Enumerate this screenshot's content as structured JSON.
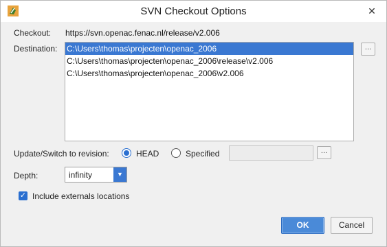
{
  "window": {
    "title": "SVN Checkout Options",
    "close_glyph": "✕",
    "app_icon": "app-icon"
  },
  "form": {
    "checkout_label": "Checkout:",
    "checkout_url": "https://svn.openac.fenac.nl/release/v2.006",
    "destination_label": "Destination:",
    "destinations": [
      "C:\\Users\\thomas\\projecten\\openac_2006",
      "C:\\Users\\thomas\\projecten\\openac_2006\\release\\v2.006",
      "C:\\Users\\thomas\\projecten\\openac_2006\\v2.006"
    ],
    "browse_glyph": "...",
    "revision_label": "Update/Switch to revision:",
    "head_label": "HEAD",
    "specified_label": "Specified",
    "specified_value": "",
    "revision_browse_glyph": "...",
    "depth_label": "Depth:",
    "depth_value": "infinity",
    "include_externals_label": "Include externals locations",
    "check_glyph": "✓"
  },
  "buttons": {
    "ok": "OK",
    "cancel": "Cancel"
  },
  "colors": {
    "accent": "#3a78d2",
    "selection": "#3a78d2"
  }
}
